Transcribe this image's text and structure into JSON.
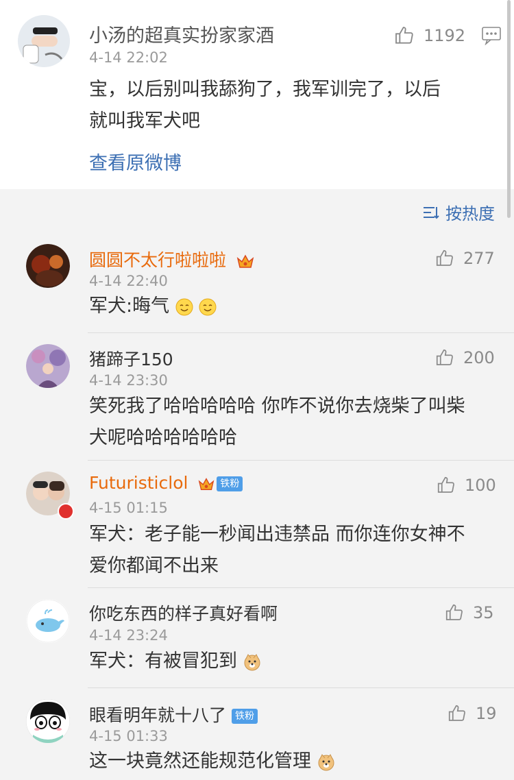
{
  "post": {
    "user": "小汤的超真实扮家家酒",
    "time": "4-14 22:02",
    "likes": "1192",
    "text_line1": "宝，以后别叫我舔狗了，我军训完了，以后",
    "text_line2": "就叫我军犬吧",
    "view_original": "查看原微博"
  },
  "sort": {
    "label": "按热度",
    "icon": "sort-icon"
  },
  "comments": [
    {
      "user": "圆圆不太行啦啦啦",
      "time": "4-14 22:40",
      "likes": "277",
      "text": "军犬:晦气",
      "emoji": "smile-emoji",
      "has_vip": true,
      "has_badge": false
    },
    {
      "user": "猪蹄子150",
      "time": "4-14 23:30",
      "likes": "200",
      "text_line1": "笑死我了哈哈哈哈哈 你咋不说你去烧柴了叫柴",
      "text_line2": "犬呢哈哈哈哈哈哈"
    },
    {
      "user": "Futuristiclol",
      "badge": "铁粉",
      "time": "4-15 01:15",
      "likes": "100",
      "text_line1": "军犬：老子能一秒闻出违禁品 而你连你女神不",
      "text_line2": "爱你都闻不出来"
    },
    {
      "user": "你吃东西的样子真好看啊",
      "time": "4-14 23:24",
      "likes": "35",
      "text": "军犬：有被冒犯到",
      "emoji": "doge-emoji"
    },
    {
      "user": "眼看明年就十八了",
      "badge": "铁粉",
      "time": "4-15 01:33",
      "likes": "19",
      "text": "这一块竟然还能规范化管理",
      "emoji": "doge-emoji"
    }
  ],
  "colors": {
    "orange": "#e86a0c",
    "blue": "#3c6fb3",
    "badge_blue": "#4f9ee8",
    "gray_text": "#9a9a9a"
  }
}
